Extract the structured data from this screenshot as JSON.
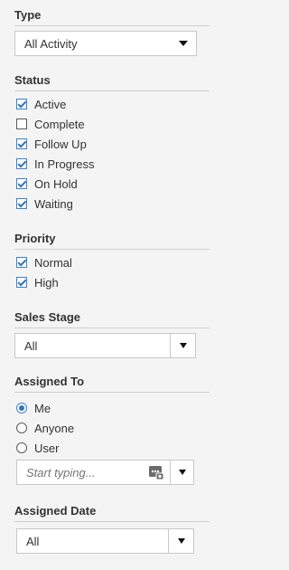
{
  "type": {
    "title": "Type",
    "selected": "All Activity"
  },
  "status": {
    "title": "Status",
    "options": [
      {
        "label": "Active",
        "checked": true
      },
      {
        "label": "Complete",
        "checked": false
      },
      {
        "label": "Follow Up",
        "checked": true
      },
      {
        "label": "In Progress",
        "checked": true
      },
      {
        "label": "On Hold",
        "checked": true
      },
      {
        "label": "Waiting",
        "checked": true
      }
    ]
  },
  "priority": {
    "title": "Priority",
    "options": [
      {
        "label": "Normal",
        "checked": true
      },
      {
        "label": "High",
        "checked": true
      }
    ]
  },
  "sales_stage": {
    "title": "Sales Stage",
    "selected": "All"
  },
  "assigned_to": {
    "title": "Assigned To",
    "options": [
      {
        "label": "Me",
        "checked": true
      },
      {
        "label": "Anyone",
        "checked": false
      },
      {
        "label": "User",
        "checked": false
      }
    ],
    "user_input": {
      "placeholder": "Start typing...",
      "value": ""
    }
  },
  "assigned_date": {
    "title": "Assigned Date",
    "selected": "All"
  },
  "colors": {
    "accent": "#2f76c0",
    "background": "#f4f4f4",
    "border": "#c8c8c8"
  }
}
